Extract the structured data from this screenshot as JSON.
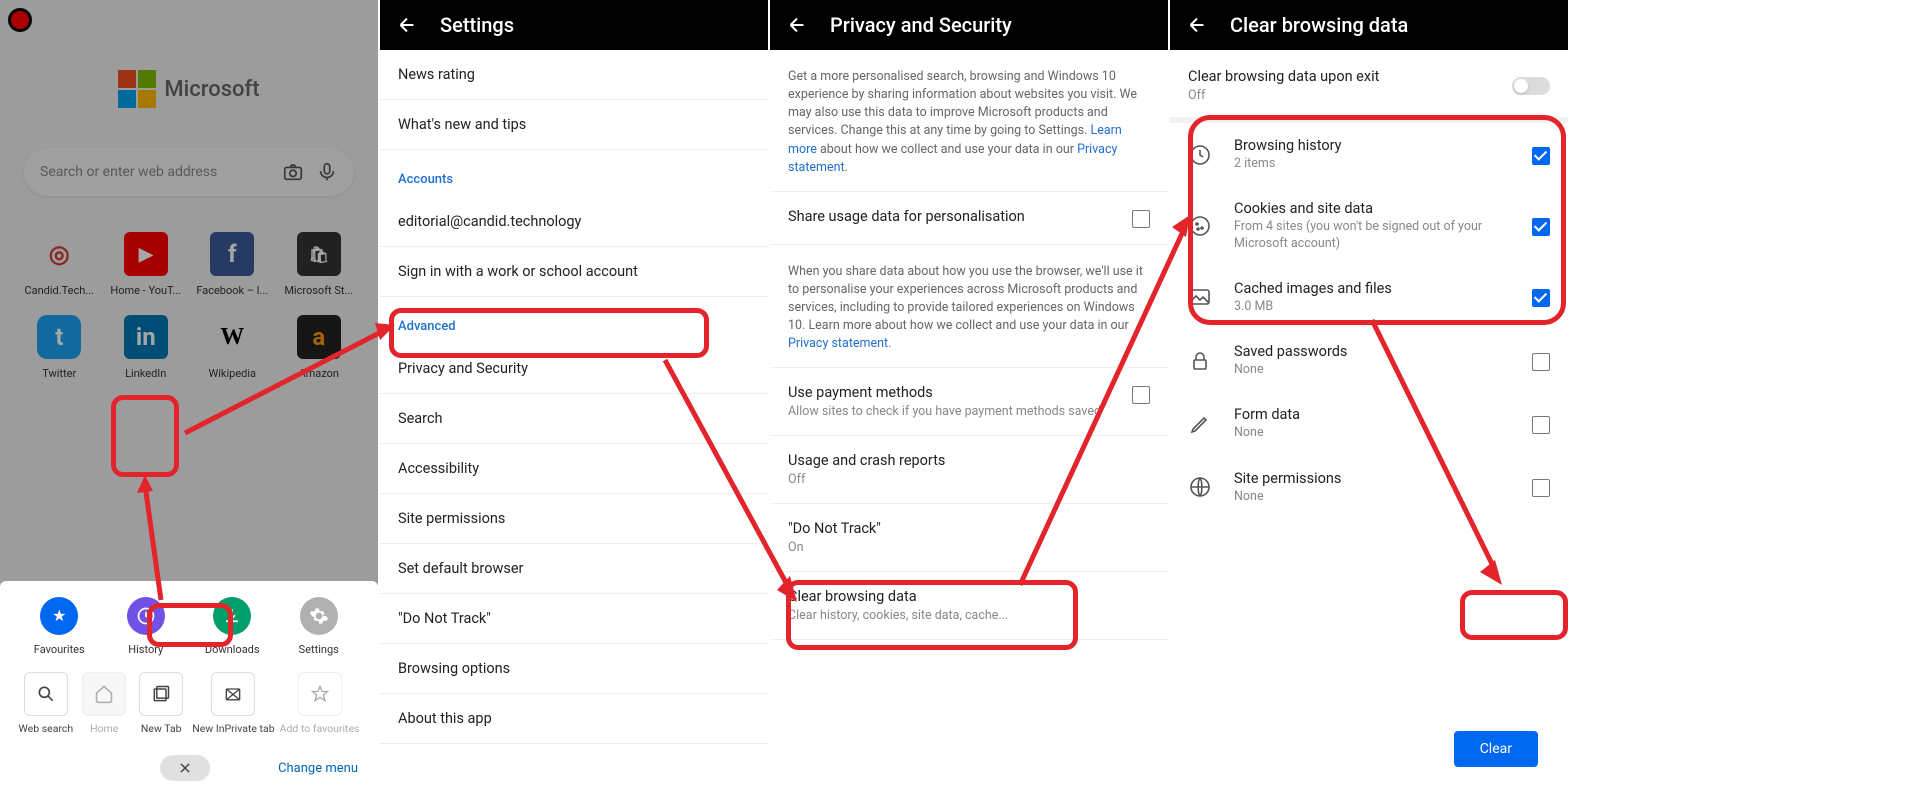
{
  "panel1": {
    "brand": "Microsoft",
    "search_placeholder": "Search or enter web address",
    "tiles": [
      {
        "label": "Candid.Tech...",
        "icon": "ct"
      },
      {
        "label": "Home - YouT...",
        "icon": "yt"
      },
      {
        "label": "Facebook – l...",
        "icon": "fb"
      },
      {
        "label": "Microsoft St...",
        "icon": "ms"
      },
      {
        "label": "Twitter",
        "icon": "tw"
      },
      {
        "label": "LinkedIn",
        "icon": "li"
      },
      {
        "label": "Wikipedia",
        "icon": "wk"
      },
      {
        "label": "Amazon",
        "icon": "az"
      }
    ],
    "menu": [
      {
        "label": "Favourites",
        "color": "#0067f0"
      },
      {
        "label": "History",
        "color": "#7252e6"
      },
      {
        "label": "Downloads",
        "color": "#009e6a"
      },
      {
        "label": "Settings",
        "color": "#b0b0b0"
      }
    ],
    "actions": [
      {
        "label": "Web search"
      },
      {
        "label": "Home"
      },
      {
        "label": "New Tab"
      },
      {
        "label": "New InPrivate tab"
      },
      {
        "label": "Add to favourites"
      }
    ],
    "change_menu": "Change menu"
  },
  "panel2": {
    "title": "Settings",
    "items_top": [
      "News rating",
      "What's new and tips"
    ],
    "section_accounts": "Accounts",
    "items_accounts": [
      "editorial@candid.technology",
      "Sign in with a work or school account"
    ],
    "section_advanced": "Advanced",
    "items_advanced": [
      "Privacy and Security",
      "Search",
      "Accessibility",
      "Site permissions",
      "Set default browser",
      "\"Do Not Track\"",
      "Browsing options",
      "About this app"
    ]
  },
  "panel3": {
    "title": "Privacy and Security",
    "info1_a": "Get a more personalised search, browsing and Windows 10 experience by sharing information about websites you visit. We may also use this data to improve Microsoft products and services. Change this at any time by going to Settings. ",
    "info1_learn": "Learn more",
    "info1_b": " about how we collect and use your data in our ",
    "info1_ps": "Privacy statement",
    "share_label": "Share usage data for personalisation",
    "info2_a": "When you share data about how you use the browser, we'll use it to personalise your experiences across Microsoft products and services, including to provide tailored experiences on Windows 10. Learn more about how we collect and use your data in our ",
    "info2_ps": "Privacy statement",
    "rows": [
      {
        "title": "Use payment methods",
        "sub": "Allow sites to check if you have payment methods saved"
      },
      {
        "title": "Usage and crash reports",
        "sub": "Off"
      },
      {
        "title": "\"Do Not Track\"",
        "sub": "On"
      },
      {
        "title": "Clear browsing data",
        "sub": "Clear history, cookies, site data, cache..."
      }
    ]
  },
  "panel4": {
    "title": "Clear browsing data",
    "exit_title": "Clear browsing data upon exit",
    "exit_sub": "Off",
    "items": [
      {
        "title": "Browsing history",
        "sub": "2 items",
        "checked": true
      },
      {
        "title": "Cookies and site data",
        "sub": "From 4 sites (you won't be signed out of your Microsoft account)",
        "checked": true
      },
      {
        "title": "Cached images and files",
        "sub": "3.0 MB",
        "checked": true
      },
      {
        "title": "Saved passwords",
        "sub": "None",
        "checked": false
      },
      {
        "title": "Form data",
        "sub": "None",
        "checked": false
      },
      {
        "title": "Site permissions",
        "sub": "None",
        "checked": false
      }
    ],
    "clear_button": "Clear"
  }
}
